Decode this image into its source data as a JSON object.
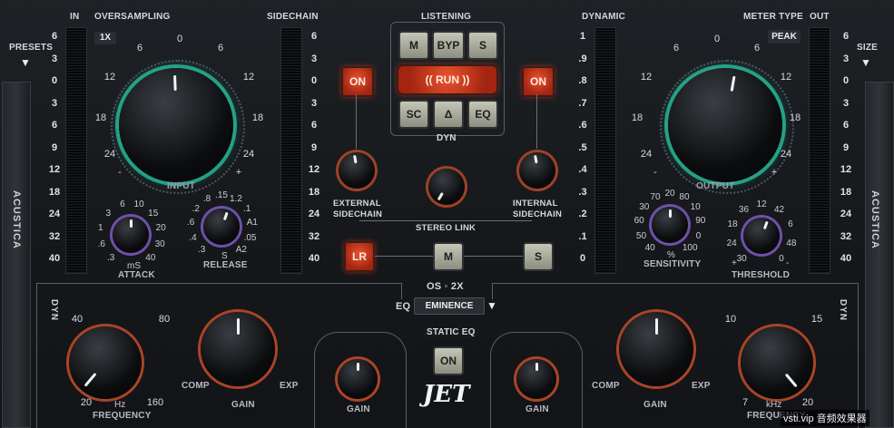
{
  "header": {
    "in": "IN",
    "oversampling": "OVERSAMPLING",
    "sidechain": "SIDECHAIN",
    "listening": "LISTENING",
    "dynamic": "DYNAMIC",
    "meter_type": "METER TYPE",
    "out": "OUT",
    "presets": "PRESETS",
    "size": "SIZE"
  },
  "oversampling_value": "1X",
  "meter_type_value": "PEAK",
  "brand": "ACUSTICA",
  "scales": {
    "left": [
      "6",
      "3",
      "0",
      "3",
      "6",
      "9",
      "12",
      "18",
      "24",
      "32",
      "40"
    ],
    "sidechain": [
      "6",
      "3",
      "0",
      "3",
      "6",
      "9",
      "12",
      "18",
      "24",
      "32",
      "40"
    ],
    "dynamic": [
      "1",
      ".9",
      ".8",
      ".7",
      ".6",
      ".5",
      ".4",
      ".3",
      ".2",
      ".1",
      "0"
    ],
    "out": [
      "6",
      "3",
      "0",
      "3",
      "6",
      "9",
      "12",
      "18",
      "24",
      "32",
      "40"
    ]
  },
  "input_knob": {
    "label": "INPUT",
    "ticks": [
      "6",
      "0",
      "6",
      "12",
      "18",
      "24",
      "-",
      "+",
      "12",
      "18",
      "24"
    ]
  },
  "output_knob": {
    "label": "OUTPUT",
    "ticks": [
      "6",
      "0",
      "6",
      "12",
      "18",
      "24",
      "-",
      "+",
      "12",
      "18",
      "24"
    ]
  },
  "attack": {
    "label": "ATTACK",
    "unit": "mS",
    "ticks": [
      ".3",
      ".6",
      "1",
      "3",
      "6",
      "10",
      "15",
      "20",
      "30",
      "40"
    ]
  },
  "release": {
    "label": "RELEASE",
    "unit": "S",
    "ticks": [
      ".3",
      ".4",
      ".6",
      ".2",
      ".8",
      ".15",
      "1.2",
      ".1",
      "A1",
      ".05",
      "A2"
    ]
  },
  "sensitivity": {
    "label": "SENSITIVITY",
    "unit": "%",
    "ticks": [
      "40",
      "50",
      "60",
      "30",
      "70",
      "20",
      "80",
      "10",
      "90",
      "0",
      "100"
    ]
  },
  "threshold": {
    "label": "THRESHOLD",
    "ticks": [
      "30",
      "24",
      "18",
      "36",
      "12",
      "42",
      "6",
      "48",
      "0"
    ],
    "sign": "+",
    "sign2": "-"
  },
  "listening": {
    "m": "M",
    "byp": "BYP",
    "s": "S",
    "run": "RUN",
    "sc": "SC",
    "delta": "Δ",
    "eq": "EQ",
    "dyn": "DYN"
  },
  "on_left": "ON",
  "on_right": "ON",
  "ext_sidechain": [
    "EXTERNAL",
    "SIDECHAIN"
  ],
  "int_sidechain": [
    "INTERNAL",
    "SIDECHAIN"
  ],
  "stereo_link": "STEREO LINK",
  "mode_buttons": {
    "lr": "LR",
    "m": "M",
    "s": "S"
  },
  "os_label": "OS ◦ 2X",
  "eq_label": "EQ",
  "eq_preset": "EMINENCE",
  "static_eq": "STATIC EQ",
  "static_on": "ON",
  "logo": "JET",
  "dyn_vertical": "DYN",
  "left_eq": {
    "freq_label": "FREQUENCY",
    "freq_unit": "Hz",
    "freq_ticks": [
      "40",
      "80",
      "20",
      "160"
    ],
    "gain_label": "GAIN",
    "comp": "COMP",
    "exp": "EXP"
  },
  "right_eq": {
    "freq_label": "FREQUENCY",
    "freq_unit": "kHz",
    "freq_ticks": [
      "10",
      "15",
      "7",
      "20"
    ],
    "gain_label": "GAIN",
    "comp": "COMP",
    "exp": "EXP"
  },
  "static_gain_left": "GAIN",
  "static_gain_right": "GAIN",
  "watermark": "vsti.vip 音频效果器",
  "colors": {
    "teal": "#2ad6b0",
    "red": "#e14a26",
    "purple": "#9d6cf0",
    "orange": "#e2562c"
  }
}
